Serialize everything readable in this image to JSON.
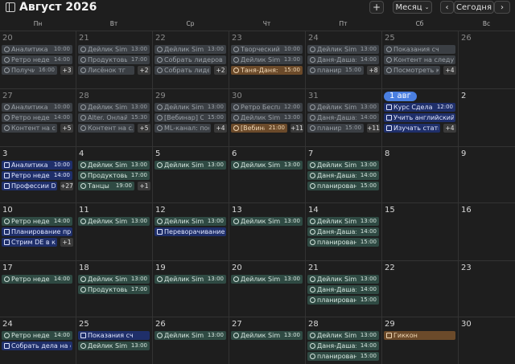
{
  "header": {
    "title": "Август 2026",
    "add": "+",
    "view": "Месяц",
    "prev": "‹",
    "today": "Сегодня",
    "next": "›"
  },
  "days_of_week": [
    "Пн",
    "Вт",
    "Ср",
    "Чт",
    "Пт",
    "Сб",
    "Вс"
  ],
  "colors": {
    "grey": "#3b3f44",
    "green": "#2f4a43",
    "blue": "#1f2f6a",
    "orange": "#6b4a2a",
    "today": "#4a7fe0"
  },
  "weeks": [
    {
      "days": [
        {
          "num": "20",
          "muted": true,
          "events": [
            {
              "icon": "clock-icon",
              "title": "Аналитика по",
              "time": "10:00",
              "color": "grey"
            },
            {
              "icon": "clock-icon",
              "title": "Ретро недели",
              "time": "14:00",
              "color": "grey"
            },
            {
              "icon": "clock-icon",
              "title": "Получить",
              "time": "16:00",
              "color": "grey"
            }
          ],
          "more": "+3"
        },
        {
          "num": "21",
          "muted": true,
          "events": [
            {
              "icon": "clock-icon",
              "title": "Дейлик Simul",
              "time": "13:00",
              "color": "grey"
            },
            {
              "icon": "clock-icon",
              "title": "Продуктовый",
              "time": "17:00",
              "color": "grey"
            },
            {
              "icon": "clock-icon",
              "title": "Лисёнок тг",
              "time": "",
              "color": "grey"
            }
          ],
          "more": "+2"
        },
        {
          "num": "22",
          "muted": true,
          "events": [
            {
              "icon": "clock-icon",
              "title": "Дейлик Simul",
              "time": "13:00",
              "color": "grey"
            },
            {
              "icon": "clock-icon",
              "title": "Собрать лидеров к",
              "time": "",
              "color": "grey"
            },
            {
              "icon": "clock-icon",
              "title": "Собрать лидер",
              "time": "",
              "color": "grey"
            }
          ],
          "more": "+2"
        },
        {
          "num": "23",
          "muted": true,
          "events": [
            {
              "icon": "clock-icon",
              "title": "Творческий к",
              "time": "10:00",
              "color": "grey"
            },
            {
              "icon": "clock-icon",
              "title": "Дейлик Simul",
              "time": "13:00",
              "color": "grey"
            },
            {
              "icon": "clock-icon",
              "title": "Таня-Даня: КГ",
              "time": "15:00",
              "color": "orange"
            }
          ],
          "more": ""
        },
        {
          "num": "24",
          "muted": true,
          "events": [
            {
              "icon": "clock-icon",
              "title": "Дейлик Simul",
              "time": "13:00",
              "color": "grey"
            },
            {
              "icon": "clock-icon",
              "title": "Даня-Даша:",
              "time": "14:00",
              "color": "grey"
            },
            {
              "icon": "clock-icon",
              "title": "планиров",
              "time": "15:00",
              "color": "grey"
            }
          ],
          "more": "+8"
        },
        {
          "num": "25",
          "muted": true,
          "events": [
            {
              "icon": "clock-icon",
              "title": "Показания сч",
              "time": "",
              "color": "grey"
            },
            {
              "icon": "clock-icon",
              "title": "Контент на следук",
              "time": "",
              "color": "grey"
            },
            {
              "icon": "clock-icon",
              "title": "Посмотреть ка",
              "time": "",
              "color": "grey"
            }
          ],
          "more": "+4"
        },
        {
          "num": "26",
          "muted": true,
          "events": [],
          "more": ""
        }
      ]
    },
    {
      "days": [
        {
          "num": "27",
          "muted": true,
          "events": [
            {
              "icon": "clock-icon",
              "title": "Аналитика по",
              "time": "10:00",
              "color": "grey"
            },
            {
              "icon": "clock-icon",
              "title": "Ретро недели",
              "time": "14:00",
              "color": "grey"
            },
            {
              "icon": "clock-icon",
              "title": "Контент на сле",
              "time": "",
              "color": "grey"
            }
          ],
          "more": "+5"
        },
        {
          "num": "28",
          "muted": true,
          "events": [
            {
              "icon": "clock-icon",
              "title": "Дейлик Simul",
              "time": "13:00",
              "color": "grey"
            },
            {
              "icon": "clock-icon",
              "title": "Alter. Онлайн",
              "time": "15:30",
              "color": "grey"
            },
            {
              "icon": "clock-icon",
              "title": "Контент на сле",
              "time": "",
              "color": "grey"
            }
          ],
          "more": "+5"
        },
        {
          "num": "29",
          "muted": true,
          "events": [
            {
              "icon": "clock-icon",
              "title": "Дейлик Simul",
              "time": "13:00",
              "color": "grey"
            },
            {
              "icon": "clock-icon",
              "title": "[Вебинар] От",
              "time": "15:00",
              "color": "grey"
            },
            {
              "icon": "clock-icon",
              "title": "ML-канал: пос",
              "time": "",
              "color": "grey"
            }
          ],
          "more": "+4"
        },
        {
          "num": "30",
          "muted": true,
          "events": [
            {
              "icon": "clock-icon",
              "title": "Ретро Беспл",
              "time": "12:00",
              "color": "grey"
            },
            {
              "icon": "clock-icon",
              "title": "Дейлик Simul",
              "time": "13:00",
              "color": "grey"
            },
            {
              "icon": "clock-icon",
              "title": "[Вебина]",
              "time": "21:00",
              "color": "orange"
            }
          ],
          "more": "+11"
        },
        {
          "num": "31",
          "muted": true,
          "events": [
            {
              "icon": "clock-icon",
              "title": "Дейлик Simul",
              "time": "13:00",
              "color": "grey"
            },
            {
              "icon": "clock-icon",
              "title": "Даня-Даша:",
              "time": "14:00",
              "color": "grey"
            },
            {
              "icon": "clock-icon",
              "title": "планирс",
              "time": "15:00",
              "color": "grey"
            }
          ],
          "more": "+11"
        },
        {
          "num": "1 авг",
          "today": true,
          "events": [
            {
              "icon": "square-icon",
              "title": "Курс Сделаем",
              "time": "12:00",
              "color": "blue"
            },
            {
              "icon": "check-icon",
              "title": "Учить английский",
              "time": "",
              "color": "blue"
            },
            {
              "icon": "check-icon",
              "title": "Изучать статьи",
              "time": "",
              "color": "blue"
            }
          ],
          "more": "+4"
        },
        {
          "num": "2",
          "events": [],
          "more": ""
        }
      ]
    },
    {
      "days": [
        {
          "num": "3",
          "events": [
            {
              "icon": "square-icon",
              "title": "Аналитика по",
              "time": "10:00",
              "color": "blue"
            },
            {
              "icon": "square-icon",
              "title": "Ретро недели",
              "time": "14:00",
              "color": "blue"
            },
            {
              "icon": "square-icon",
              "title": "Профессии D",
              "time": "",
              "color": "blue"
            }
          ],
          "more": "+27"
        },
        {
          "num": "4",
          "events": [
            {
              "icon": "clock-icon",
              "title": "Дейлик Simul",
              "time": "13:00",
              "color": "green"
            },
            {
              "icon": "clock-icon",
              "title": "Продуктовый",
              "time": "17:00",
              "color": "green"
            },
            {
              "icon": "clock-icon",
              "title": "Танцы",
              "time": "19:00",
              "color": "green"
            }
          ],
          "more": "+1"
        },
        {
          "num": "5",
          "events": [
            {
              "icon": "clock-icon",
              "title": "Дейлик Simul",
              "time": "13:00",
              "color": "green"
            }
          ],
          "more": ""
        },
        {
          "num": "6",
          "events": [
            {
              "icon": "clock-icon",
              "title": "Дейлик Simul",
              "time": "13:00",
              "color": "green"
            }
          ],
          "more": ""
        },
        {
          "num": "7",
          "events": [
            {
              "icon": "clock-icon",
              "title": "Дейлик Simul",
              "time": "13:00",
              "color": "green"
            },
            {
              "icon": "clock-icon",
              "title": "Даня-Даша:",
              "time": "14:00",
              "color": "green"
            },
            {
              "icon": "clock-icon",
              "title": "планировани",
              "time": "15:00",
              "color": "green"
            }
          ],
          "more": ""
        },
        {
          "num": "8",
          "events": [],
          "more": ""
        },
        {
          "num": "9",
          "events": [],
          "more": ""
        }
      ]
    },
    {
      "days": [
        {
          "num": "10",
          "events": [
            {
              "icon": "clock-icon",
              "title": "Ретро недели",
              "time": "14:00",
              "color": "green"
            },
            {
              "icon": "square-icon",
              "title": "Планирование про",
              "time": "",
              "color": "blue"
            },
            {
              "icon": "square-icon",
              "title": "Стрим DE в ко",
              "time": "",
              "color": "blue"
            }
          ],
          "more": "+1"
        },
        {
          "num": "11",
          "events": [
            {
              "icon": "clock-icon",
              "title": "Дейлик Simul",
              "time": "13:00",
              "color": "green"
            }
          ],
          "more": ""
        },
        {
          "num": "12",
          "events": [
            {
              "icon": "clock-icon",
              "title": "Дейлик Simul",
              "time": "13:00",
              "color": "green"
            },
            {
              "icon": "square-icon",
              "title": "Переворачивание",
              "time": "",
              "color": "blue"
            }
          ],
          "more": ""
        },
        {
          "num": "13",
          "events": [
            {
              "icon": "clock-icon",
              "title": "Дейлик Simul",
              "time": "13:00",
              "color": "green"
            }
          ],
          "more": ""
        },
        {
          "num": "14",
          "events": [
            {
              "icon": "clock-icon",
              "title": "Дейлик Simul",
              "time": "13:00",
              "color": "green"
            },
            {
              "icon": "clock-icon",
              "title": "Даня-Даша:",
              "time": "14:00",
              "color": "green"
            },
            {
              "icon": "clock-icon",
              "title": "планировани",
              "time": "15:00",
              "color": "green"
            }
          ],
          "more": ""
        },
        {
          "num": "15",
          "events": [],
          "more": ""
        },
        {
          "num": "16",
          "events": [],
          "more": ""
        }
      ]
    },
    {
      "days": [
        {
          "num": "17",
          "events": [
            {
              "icon": "clock-icon",
              "title": "Ретро недели",
              "time": "14:00",
              "color": "green"
            }
          ],
          "more": ""
        },
        {
          "num": "18",
          "events": [
            {
              "icon": "clock-icon",
              "title": "Дейлик Simul",
              "time": "13:00",
              "color": "green"
            },
            {
              "icon": "clock-icon",
              "title": "Продуктовый",
              "time": "17:00",
              "color": "green"
            }
          ],
          "more": ""
        },
        {
          "num": "19",
          "events": [
            {
              "icon": "clock-icon",
              "title": "Дейлик Simul",
              "time": "13:00",
              "color": "green"
            }
          ],
          "more": ""
        },
        {
          "num": "20",
          "events": [
            {
              "icon": "clock-icon",
              "title": "Дейлик Simul",
              "time": "13:00",
              "color": "green"
            }
          ],
          "more": ""
        },
        {
          "num": "21",
          "events": [
            {
              "icon": "clock-icon",
              "title": "Дейлик Simul",
              "time": "13:00",
              "color": "green"
            },
            {
              "icon": "clock-icon",
              "title": "Даня-Даша:",
              "time": "14:00",
              "color": "green"
            },
            {
              "icon": "clock-icon",
              "title": "планировани",
              "time": "15:00",
              "color": "green"
            }
          ],
          "more": ""
        },
        {
          "num": "22",
          "events": [],
          "more": ""
        },
        {
          "num": "23",
          "events": [],
          "more": ""
        }
      ]
    },
    {
      "days": [
        {
          "num": "24",
          "events": [
            {
              "icon": "clock-icon",
              "title": "Ретро недели",
              "time": "14:00",
              "color": "green"
            },
            {
              "icon": "square-icon",
              "title": "Собрать дела на о",
              "time": "",
              "color": "blue"
            }
          ],
          "more": ""
        },
        {
          "num": "25",
          "events": [
            {
              "icon": "square-icon",
              "title": "Показания сч",
              "time": "",
              "color": "blue"
            },
            {
              "icon": "clock-icon",
              "title": "Дейлик Simul",
              "time": "13:00",
              "color": "green"
            }
          ],
          "more": ""
        },
        {
          "num": "26",
          "events": [
            {
              "icon": "clock-icon",
              "title": "Дейлик Simul",
              "time": "13:00",
              "color": "green"
            }
          ],
          "more": ""
        },
        {
          "num": "27",
          "events": [
            {
              "icon": "clock-icon",
              "title": "Дейлик Simul",
              "time": "13:00",
              "color": "green"
            }
          ],
          "more": ""
        },
        {
          "num": "28",
          "events": [
            {
              "icon": "clock-icon",
              "title": "Дейлик Simul",
              "time": "13:00",
              "color": "green"
            },
            {
              "icon": "clock-icon",
              "title": "Даня-Даша:",
              "time": "14:00",
              "color": "green"
            },
            {
              "icon": "clock-icon",
              "title": "планировани",
              "time": "15:00",
              "color": "green"
            }
          ],
          "more": ""
        },
        {
          "num": "29",
          "events": [
            {
              "icon": "square-icon",
              "title": "Гиккон",
              "time": "",
              "color": "orange"
            }
          ],
          "more": ""
        },
        {
          "num": "30",
          "events": [],
          "more": ""
        }
      ]
    }
  ]
}
